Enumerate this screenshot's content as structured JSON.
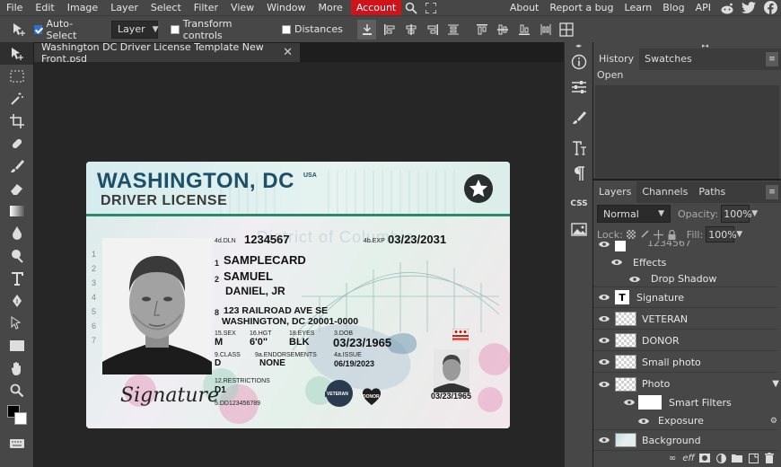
{
  "menu": {
    "items": [
      "File",
      "Edit",
      "Image",
      "Layer",
      "Select",
      "Filter",
      "View",
      "Window",
      "More"
    ],
    "account": "Account",
    "right_items": [
      "About",
      "Report a bug",
      "Learn",
      "Blog",
      "API"
    ]
  },
  "options": {
    "auto_select_label": "Auto-Select",
    "auto_select_checked": true,
    "layer_select_value": "Layer",
    "transform_label": "Transform controls",
    "distances_label": "Distances"
  },
  "document": {
    "tab_title": "Washington DC Driver License Template New Front.psd"
  },
  "license": {
    "state": "WASHINGTON, DC",
    "usa": "USA",
    "type": "DRIVER LICENSE",
    "watermark": "District of Columbia",
    "dln_label": "4d.DLN",
    "dln": "1234567",
    "exp_label": "4b.EXP",
    "exp": "03/23/2031",
    "last_name": "SAMPLECARD",
    "first_name": "SAMUEL",
    "middle_name": "DANIEL, JR",
    "address1": "123 RAILROAD AVE SE",
    "address2": "WASHINGTON, DC 20001-0000",
    "sex_label": "15.SEX",
    "sex": "M",
    "hgt_label": "16.HGT",
    "hgt": "6'0\"",
    "eyes_label": "18.EYES",
    "eyes": "BLK",
    "dob_label": "3.DOB",
    "dob": "03/23/1965",
    "class_label": "9.CLASS",
    "class": "D",
    "end_label": "9a.ENDORSEMENTS",
    "end": "NONE",
    "iss_label": "4a.ISSUE",
    "iss": "06/19/2023",
    "restr_label": "12.RESTRICTIONS",
    "restr": "D1",
    "dd_label": "5.DD",
    "dd": "123456789",
    "signature": "Signature",
    "small_dob": "03/23/1965",
    "veteran": "VETERAN",
    "donor": "DONOR",
    "side_numbers": "1 2 3 4 5 6 7",
    "field_numbers": [
      "1",
      "2",
      "8"
    ]
  },
  "right_column": {
    "css_label": "CSS"
  },
  "history": {
    "tabs": [
      "History",
      "Swatches"
    ],
    "entries": [
      "Open"
    ]
  },
  "layers": {
    "tabs": [
      "Layers",
      "Channels",
      "Paths"
    ],
    "blend_mode": "Normal",
    "opacity_label": "Opacity:",
    "opacity": "100%",
    "lock_label": "Lock:",
    "fill_label": "Fill:",
    "fill": "100%",
    "partial_top": "1234567",
    "effects": "Effects",
    "drop_shadow": "Drop Shadow",
    "rows": [
      "Signature",
      "VETERAN",
      "DONOR",
      "Small photo",
      "Photo"
    ],
    "smart_filters": "Smart Filters",
    "exposure": "Exposure",
    "background": "Background"
  }
}
